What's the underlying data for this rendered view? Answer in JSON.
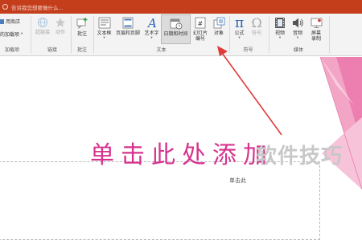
{
  "tellme": {
    "text": "告诉我您想要做什么..."
  },
  "addins": {
    "store_label": "用商店",
    "my_addins_label": "的加载项",
    "group_label": "加载项"
  },
  "links": {
    "hyperlink_label": "超链接",
    "action_label": "动作",
    "group_label": "链接"
  },
  "comments": {
    "comment_label": "批注",
    "group_label": "批注"
  },
  "text_group": {
    "textbox_label": "文本框",
    "header_footer_label": "页眉和页脚",
    "wordart_label": "艺术字",
    "datetime_label": "日期和时间",
    "slide_number_label_1": "幻灯片",
    "slide_number_label_2": "编号",
    "object_label": "对象",
    "group_label": "文本"
  },
  "symbols": {
    "equation_label": "公式",
    "symbol_label": "符号",
    "group_label": "符号"
  },
  "media": {
    "video_label": "视频",
    "audio_label": "音频",
    "screen_record_label_1": "屏幕",
    "screen_record_label_2": "录制",
    "group_label": "媒体"
  },
  "slide": {
    "title_placeholder": "单击此处添加",
    "subtitle_placeholder": "单击此"
  },
  "watermark": {
    "text": "软件技巧"
  },
  "colors": {
    "titlebar": "#c43e1c",
    "accent_pink": "#d6338e",
    "arrow_red": "#e03a3a"
  }
}
